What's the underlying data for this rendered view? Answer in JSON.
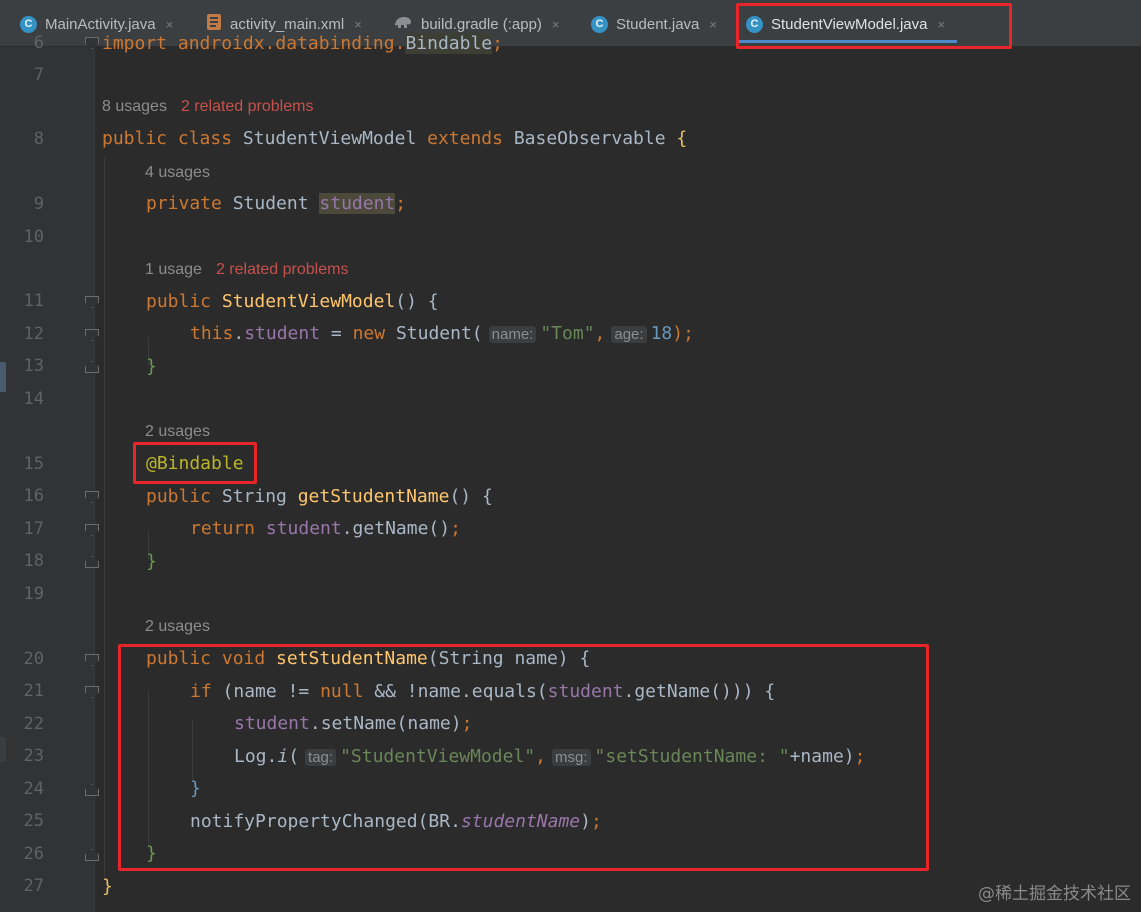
{
  "tabs": [
    {
      "label": "MainActivity.java",
      "icon": "java-class-icon",
      "active": false
    },
    {
      "label": "activity_main.xml",
      "icon": "xml-layout-icon",
      "active": false
    },
    {
      "label": "build.gradle (:app)",
      "icon": "gradle-icon",
      "active": false
    },
    {
      "label": "Student.java",
      "icon": "java-class-icon",
      "active": false
    },
    {
      "label": "StudentViewModel.java",
      "icon": "java-class-icon",
      "active": true
    }
  ],
  "close_glyph": "×",
  "java_icon_letter": "C",
  "line_numbers": [
    "6",
    "7",
    "8",
    "9",
    "10",
    "11",
    "12",
    "13",
    "14",
    "15",
    "16",
    "17",
    "18",
    "19",
    "20",
    "21",
    "22",
    "23",
    "24",
    "25",
    "26",
    "27"
  ],
  "hints": {
    "class_usages": "8 usages",
    "class_problems": "2 related problems",
    "field_usages": "4 usages",
    "ctor_usages": "1 usage",
    "ctor_problems": "2 related problems",
    "getter_usages": "2 usages",
    "setter_usages": "2 usages"
  },
  "code": {
    "l6_import": "import androidx.databinding.",
    "l6_cls": "Bindable",
    "l6_semi": ";",
    "l8_kw": "public class ",
    "l8_name": "StudentViewModel ",
    "l8_ext": "extends ",
    "l8_base": "BaseObservable ",
    "l8_brace": "{",
    "l9_kw": "private ",
    "l9_type": "Student ",
    "l9_field": "student",
    "l9_semi": ";",
    "l11_kw": "public ",
    "l11_name": "StudentViewModel",
    "l11_rest": "() {",
    "l12_this": "this",
    "l12_dot": ".",
    "l12_field": "student",
    "l12_eq": " = ",
    "l12_new": "new ",
    "l12_type": "Student(",
    "l12_hint_name": "name:",
    "l12_str": "\"Tom\"",
    "l12_comma": ",",
    "l12_hint_age": "age:",
    "l12_num": "18",
    "l12_end": ");",
    "l13_brace": "}",
    "l15_ann": "@Bindable",
    "l16_kw": "public ",
    "l16_type": "String ",
    "l16_name": "getStudentName",
    "l16_rest": "() {",
    "l17_kw": "return ",
    "l17_field": "student",
    "l17_call": ".getName()",
    "l17_semi": ";",
    "l18_brace": "}",
    "l20_kw": "public void ",
    "l20_name": "setStudentName",
    "l20_rest": "(String name) {",
    "l21_kw": "if ",
    "l21_a": "(name != ",
    "l21_null": "null ",
    "l21_b": "&& !name.equals(",
    "l21_field": "student",
    "l21_c": ".getName())) {",
    "l22_field": "student",
    "l22_rest": ".setName(name)",
    "l22_semi": ";",
    "l23_cls": "Log.",
    "l23_fn": "i",
    "l23_paren": "(",
    "l23_hint_tag": "tag:",
    "l23_str1": "\"StudentViewModel\"",
    "l23_comma": ",",
    "l23_hint_msg": "msg:",
    "l23_str2": "\"setStudentName: \"",
    "l23_rest": "+name)",
    "l23_semi": ";",
    "l24_brace": "}",
    "l25_call": "notifyPropertyChanged(BR.",
    "l25_field": "studentName",
    "l25_end": ")",
    "l25_semi": ";",
    "l26_brace": "}",
    "l27_brace": "}"
  },
  "watermark": "@稀土掘金技术社区",
  "colors": {
    "highlight_box": "#e8262a",
    "keyword": "#cc7832",
    "field": "#9876aa",
    "string": "#6a8759",
    "number": "#6897bb",
    "method": "#ffc66d",
    "annotation": "#bbb529"
  }
}
